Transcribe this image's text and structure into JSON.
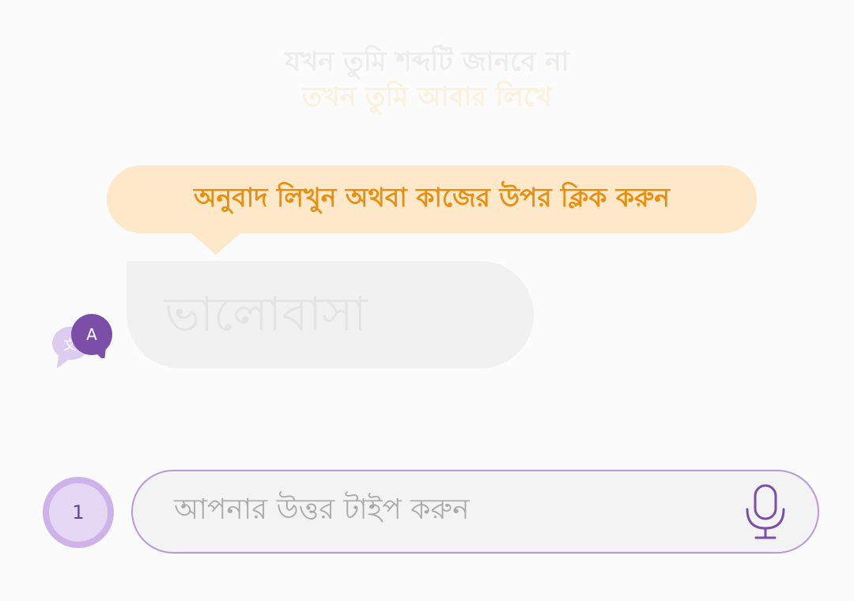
{
  "header": {
    "line1": "যখন তুমি শব্দটি জানবে না",
    "line2": "তখন তুমি আবার লিখে"
  },
  "tooltip": {
    "text": "অনুবাদ লিখুন অথবা কাজের উপর ক্লিক করুন"
  },
  "word_card": {
    "word": "ভালোবাসা"
  },
  "avatar": {
    "initial": "A",
    "translate_glyph": "文"
  },
  "step": {
    "number": "1"
  },
  "answer_input": {
    "placeholder": "আপনার উত্তর টাইপ করুন"
  },
  "icons": {
    "translate": "translate-icon",
    "avatar": "avatar-badge-icon",
    "mic": "microphone-icon"
  },
  "colors": {
    "accent_purple": "#7b4fa8",
    "tooltip_bg": "#fde8ca",
    "tooltip_text": "#e7900f",
    "input_border": "#b79ad6"
  }
}
